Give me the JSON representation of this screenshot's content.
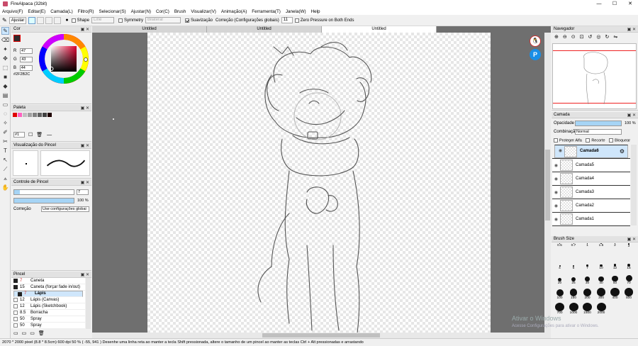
{
  "window": {
    "title": "FireAlpaca (32bit)",
    "minimize": "—",
    "maximize": "☐",
    "close": "✕"
  },
  "menu": [
    "Arquivo(F)",
    "Editar(E)",
    "Camada(L)",
    "Filtro(R)",
    "Selecionar(S)",
    "Ajustar(N)",
    "Cor(C)",
    "Brush",
    "Visualizar(V)",
    "Animação(A)",
    "Ferramenta(T)",
    "Janela(W)",
    "Help"
  ],
  "toolbar": {
    "adjust": "Ajustar",
    "shape_label": "Shape",
    "shape_value": "Line",
    "symmetry_label": "Symmetry",
    "symmetry_value": "Bilateral",
    "smoothing_label": "Suavização",
    "correction_label": "Correção (Configurações globais)",
    "correction_value": "11",
    "zero_pressure_label": "Zero Pressure on Both Ends"
  },
  "color_panel": {
    "title": "Cor",
    "r_label": "R",
    "r": "47",
    "g_label": "G",
    "g": "43",
    "b_label": "B",
    "b": "44",
    "hex": "#2F2B2C",
    "primary": "#2f2b2c",
    "secondary": "#ffffff"
  },
  "palette_panel": {
    "title": "Paleta",
    "swatches": [
      "#e00000",
      "#ff60c0",
      "#c0c0c0",
      "#a0a0a0",
      "#808080",
      "#606060",
      "#404040",
      "#200000"
    ],
    "select": "#1"
  },
  "brush_preview": {
    "title": "Visualização do Pincel"
  },
  "brush_control": {
    "title": "Controle de Pincel",
    "size": "7",
    "opacity": "100 %",
    "opacity_level": 1.0,
    "size_level": 0.1,
    "correction_label": "Correção",
    "correction_value": "Use configurações globai"
  },
  "brush_list": {
    "title": "Pincel",
    "items": [
      {
        "size": "7",
        "name": "Caneta",
        "color": "dark"
      },
      {
        "size": "15",
        "name": "Caneta (forçar fade in/out)",
        "color": "dark"
      },
      {
        "size": "7",
        "name": "Lápis",
        "color": "dark",
        "selected": true
      },
      {
        "size": "12",
        "name": "Lápis (Canvas)",
        "color": "white"
      },
      {
        "size": "12",
        "name": "Lápis (Sketchbook)",
        "color": "white"
      },
      {
        "size": "8.5",
        "name": "Borracha",
        "color": "white"
      },
      {
        "size": "50",
        "name": "Spray",
        "color": "white"
      },
      {
        "size": "50",
        "name": "Spray",
        "color": "white"
      }
    ]
  },
  "tabs": [
    "Untitled",
    "Untitled",
    "Untitled"
  ],
  "navigator": {
    "title": "Navegador"
  },
  "layer_panel": {
    "title": "Camada",
    "opacity_label": "Opacidade",
    "opacity_value": "100 %",
    "blend_label": "Combinação",
    "blend_value": "Normal",
    "protect_alpha": "Proteger Alfa",
    "clipping": "Recorte",
    "lock": "Bloquear",
    "layers": [
      "Camada6",
      "Camada5",
      "Camada4",
      "Camada3",
      "Camada2",
      "Camada1"
    ]
  },
  "brush_size_panel": {
    "title": "Brush Size",
    "sizes": [
      "0.5",
      "0.7",
      "1",
      "1.5",
      "2",
      "3",
      "4",
      "5",
      "7",
      "10",
      "12",
      "15",
      "20",
      "25",
      "30",
      "40",
      "50",
      "70",
      "100",
      "150",
      "200",
      "300",
      "400",
      "500",
      "700",
      "1000",
      "1500",
      "2000"
    ]
  },
  "status": {
    "text": "2070 * 2000 pixel   (8.8 * 8.5cm)   600 dpi   50 %   ( -55, 941 )   Desenhe uma linha reta ao manter a tecla Shift pressionada, altere o tamanho de um pincel ao manter as teclas Ctrl + Alt pressionadas e arrastando"
  },
  "watermark": {
    "line1": "Ativar o Windows",
    "line2": "Acesse Configurações para ativar o Windows."
  }
}
